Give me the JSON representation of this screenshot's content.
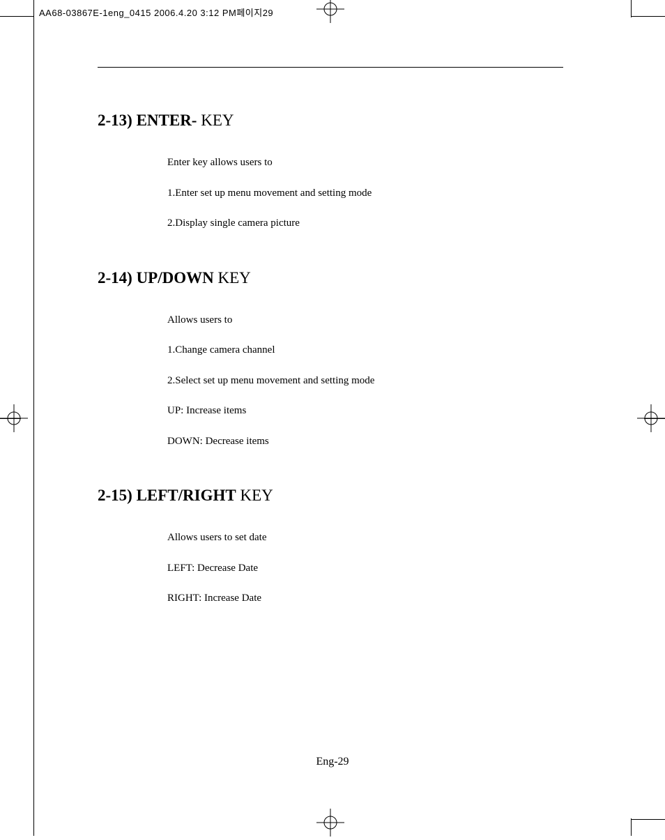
{
  "header": {
    "slug": "AA68-03867E-1eng_0415  2006.4.20 3:12 PM페이지29"
  },
  "sections": [
    {
      "heading_bold": "2-13) ENTER-",
      "heading_light": " KEY",
      "lines": [
        "Enter key allows users  to",
        "1.Enter set up menu movement and setting mode",
        "2.Display single camera picture"
      ]
    },
    {
      "heading_bold": "2-14) UP/DOWN",
      "heading_light": " KEY",
      "lines": [
        "Allows users to",
        "1.Change  camera  channel",
        "2.Select set up menu movement and setting mode",
        "UP: Increase items",
        "DOWN: Decrease items"
      ]
    },
    {
      "heading_bold": "2-15) LEFT/RIGHT",
      "heading_light": " KEY",
      "lines": [
        "Allows users to set date",
        "LEFT: Decrease Date",
        "RIGHT:  Increase Date"
      ]
    }
  ],
  "page_number": "Eng-29"
}
